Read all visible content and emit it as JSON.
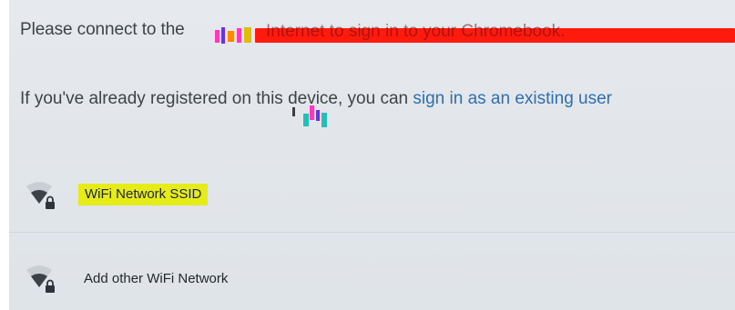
{
  "prompt": {
    "connect_prefix": "Please connect to the",
    "connect_redacted": "Internet to sign in to your Chromebook.",
    "registered_prefix": "If you've already registered on this device, you can",
    "signin_link": "sign in as an existing user"
  },
  "networks": [
    {
      "label": "WiFi Network SSID",
      "icon": "wifi-lock-icon",
      "highlighted": true
    },
    {
      "label": "Add other WiFi Network",
      "icon": "wifi-lock-icon",
      "highlighted": false
    }
  ],
  "colors": {
    "redaction": "#ff1a0e",
    "highlight": "#e6ec1a",
    "link": "#2c6fb3"
  }
}
